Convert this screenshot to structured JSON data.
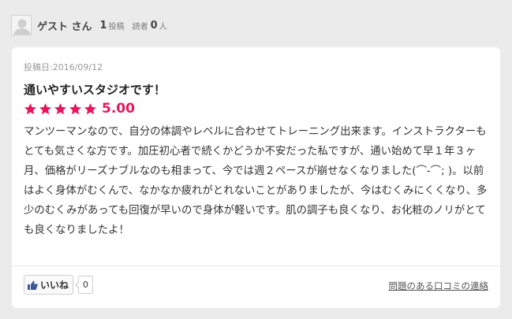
{
  "user": {
    "name": "ゲスト さん",
    "posts_count": "1",
    "posts_label": "投稿",
    "readers_label": "読者",
    "readers_count": "0",
    "readers_unit": "人"
  },
  "review": {
    "post_date": "投稿日:2016/09/12",
    "title": "通いやすいスタジオです！",
    "rating_stars": 5,
    "rating_value": "5.00",
    "body": "マンツーマンなので、自分の体調やレベルに合わせてトレーニング出来ます。インストラクターもとても気さくな方です。加圧初心者で続くかどうか不安だった私ですが、通い始めて早１年３ヶ月、価格がリーズナブルなのも相まって、今では週２ペースが崩せなくなりました(⌒-⌒; )。以前はよく身体がむくんで、なかなか疲れがとれないことがありましたが、今はむくみにくくなり、多少のむくみがあっても回復が早いので身体が軽いです。肌の調子も良くなり、お化粧のノリがとても良くなりましたよ！"
  },
  "actions": {
    "like_label": "いいね",
    "like_count": "0",
    "report_label": "問題のある口コミの連絡"
  },
  "colors": {
    "accent": "#e8175d",
    "background": "#ebebeb"
  },
  "icons": {
    "avatar": "user-silhouette-icon",
    "star": "star-icon",
    "like": "thumbs-up-icon"
  }
}
